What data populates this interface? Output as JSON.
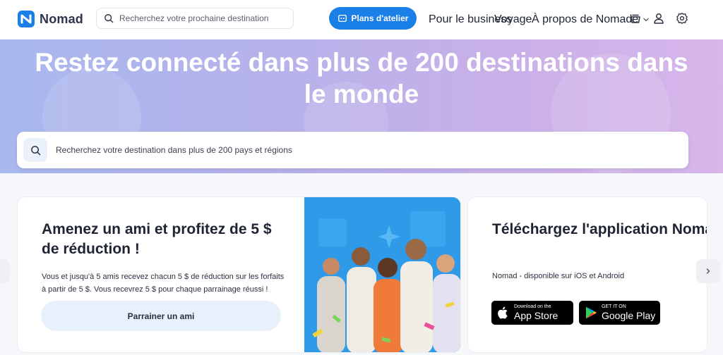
{
  "header": {
    "logo_text": "Nomad",
    "search_placeholder": "Recherchez votre prochaine destination",
    "workshop_label": "Plans d'atelier",
    "nav": {
      "business": "Pour le business",
      "voyage": "Voyage",
      "about": "À propos de Nomade"
    }
  },
  "hero": {
    "title": "Restez connecté dans plus de 200 destinations dans le monde",
    "search_placeholder": "Recherchez votre destination dans plus de 200 pays et régions"
  },
  "referral": {
    "title": "Amenez un ami et profitez de 5 $ de réduction !",
    "description": "Vous et jusqu'à 5 amis recevez chacun 5 $ de réduction sur les forfaits à partir de 5 $. Vous recevrez 5 $ pour chaque parrainage réussi !",
    "button_label": "Parrainer un ami"
  },
  "app_card": {
    "title": "Téléchargez l'application Nomad",
    "description": "Nomad - disponible sur iOS et Android",
    "app_store_small": "Download on the",
    "app_store_big": "App Store",
    "google_small": "GET IT ON",
    "google_big": "Google Play"
  },
  "colors": {
    "accent": "#1a7fe6",
    "hero_start": "#a8b8ee",
    "hero_end": "#d7b6ea",
    "photo_bg": "#2f9ae8"
  },
  "icons": [
    "nomad-logo-icon",
    "search-icon",
    "workshop-icon",
    "chevron-down-icon",
    "cup-icon",
    "user-icon",
    "gear-icon",
    "apple-icon",
    "google-play-icon",
    "chevron-left-icon",
    "chevron-right-icon"
  ]
}
